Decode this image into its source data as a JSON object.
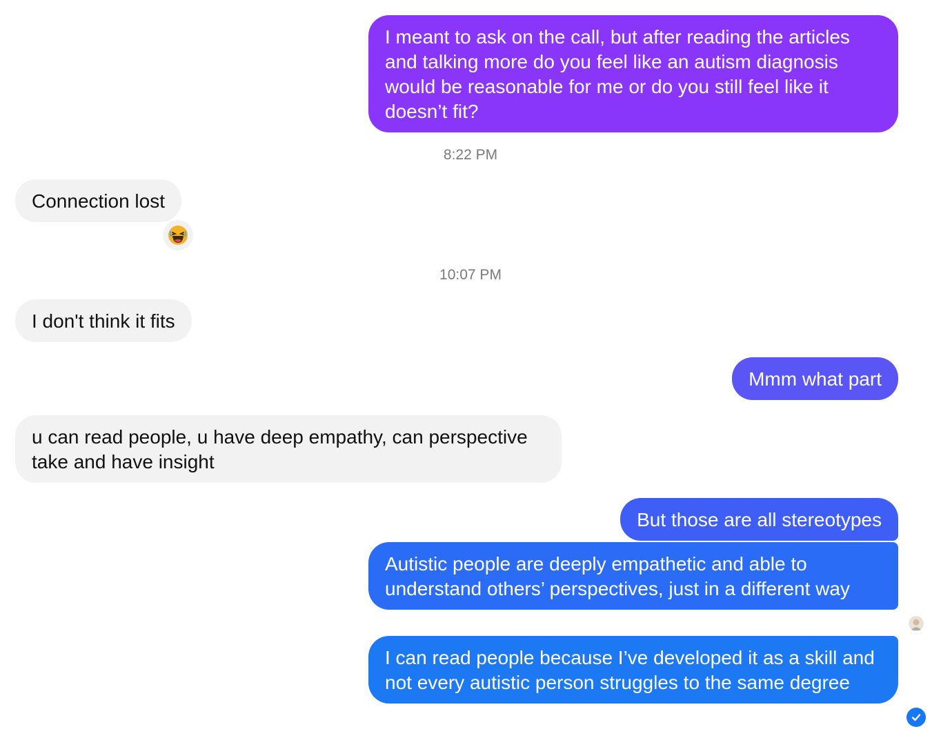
{
  "messages": [
    {
      "id": "m1",
      "direction": "outgoing",
      "text": "I meant to ask on the call, but after reading the articles and talking more do you feel like an autism diagnosis would be reasonable for me or do you still feel like it doesn’t fit?",
      "color": "#8a35fa"
    },
    {
      "id": "m2",
      "direction": "incoming",
      "text": "Connection lost",
      "reaction": "laughing-emoji"
    },
    {
      "id": "m3",
      "direction": "incoming",
      "text": "I don't think it fits"
    },
    {
      "id": "m4",
      "direction": "outgoing",
      "text": "Mmm what part",
      "color": "#5a55f5"
    },
    {
      "id": "m5",
      "direction": "incoming",
      "text": "u can read people, u have deep empathy, can perspective take and have insight"
    },
    {
      "id": "m6",
      "direction": "outgoing",
      "text": "But those are all stereotypes",
      "color": "#3f5ef6"
    },
    {
      "id": "m7",
      "direction": "outgoing",
      "text": "Autistic people are deeply empathetic and able to understand others’ perspectives, just in a different way",
      "color": "#2b6cf6"
    },
    {
      "id": "m8",
      "direction": "outgoing",
      "text": "I can read people because I’ve developed it as a skill and not every autistic person struggles to the same degree",
      "color": "#1d78f4"
    }
  ],
  "timestamps": [
    "8:22 PM",
    "10:07 PM"
  ],
  "status": {
    "seen_avatar_icon": "contact-avatar-icon",
    "delivered_icon": "check-circle-icon",
    "delivered_color": "#1877f2"
  }
}
